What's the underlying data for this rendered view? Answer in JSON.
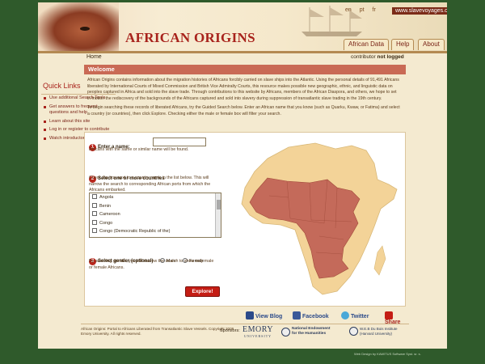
{
  "header": {
    "logo_text": "AFRICAN ORIGINS",
    "languages": [
      "en",
      "pt",
      "fr"
    ],
    "site_link": "www.slavevoyages.org",
    "buttons": [
      "African Data",
      "Help",
      "About"
    ]
  },
  "breadcrumb": "Home",
  "contributor_label": "contributor",
  "contributor_status": "not logged",
  "sidebar": {
    "title": "Quick Links",
    "items": [
      "Use additional Search Tools",
      "Get answers to frequent questions and help",
      "Learn about this site",
      "Log in or register to contribute",
      "Watch introductory video"
    ]
  },
  "welcome": {
    "title": "Welcome",
    "paragraph1": "African Origins contains information about the migration histories of Africans forcibly carried on slave ships into the Atlantic. Using the personal details of 91,491 Africans liberated by International Courts of Mixed Commission and British Vice Admiralty Courts, this resource makes possible new geographic, ethnic, and linguistic data on peoples captured in Africa and sold into the slave trade. Through contributions to this website by Africans, members of the African Diaspora, and others, we hope to set in motion the rediscovery of the backgrounds of the Africans captured and sold into slavery during suppression of transatlantic slave trading in the 19th century.",
    "paragraph2": "To begin searching these records of liberated Africans, try the Guided Search below. Enter an African name that you know (such as Quarku, Kwaw, or Fatima) and select a country (or countries), then click Explore. Checking either the male or female box will filter your search."
  },
  "search": {
    "step1_num": "1",
    "step1_title": "Enter a name:",
    "step1_value": "",
    "step1_desc": "Africans with the same or similar name will be found.",
    "step2_num": "2",
    "step2_title": "Select one or more countries",
    "step2_desc": "Check the box next to a country name in the list below. This will narrow the search to corresponding African ports from which the Africans embarked.",
    "countries": [
      "Angola",
      "Benin",
      "Cameroon",
      "Congo",
      "Congo (Democratic Republic of the)"
    ],
    "step3_num": "3",
    "step3_title": "Select gender (optional)",
    "male_label": "Male",
    "female_label": "Female",
    "step3_desc": "By selecting gender, you will narrow the search to show only male or female Africans.",
    "explore_label": "Explore!"
  },
  "social": {
    "items": [
      "View Blog",
      "Facebook",
      "Twitter",
      "Share"
    ]
  },
  "footer": {
    "text": "African Origins: Portal to Africans Liberated from Transatlantic Slave Vessels. Copyright 2009 Emory University. All rights reserved.",
    "sponsors_label": "Sponsors:",
    "emory": "EMORY",
    "emory_sub": "UNIVERSITY",
    "neh_line1": "National Endowment",
    "neh_line2": "for the Humanities",
    "dubois_line1": "W.E.B Du Bois Institute",
    "dubois_line2": "(Harvard University)",
    "web_design": "Web Design by KAWITUS Software Syst. sr. s."
  },
  "colors": {
    "accent": "#a8231c",
    "map_highlight": "#c46a5a",
    "map_base": "#f3d398",
    "background": "#2f5a2b"
  }
}
